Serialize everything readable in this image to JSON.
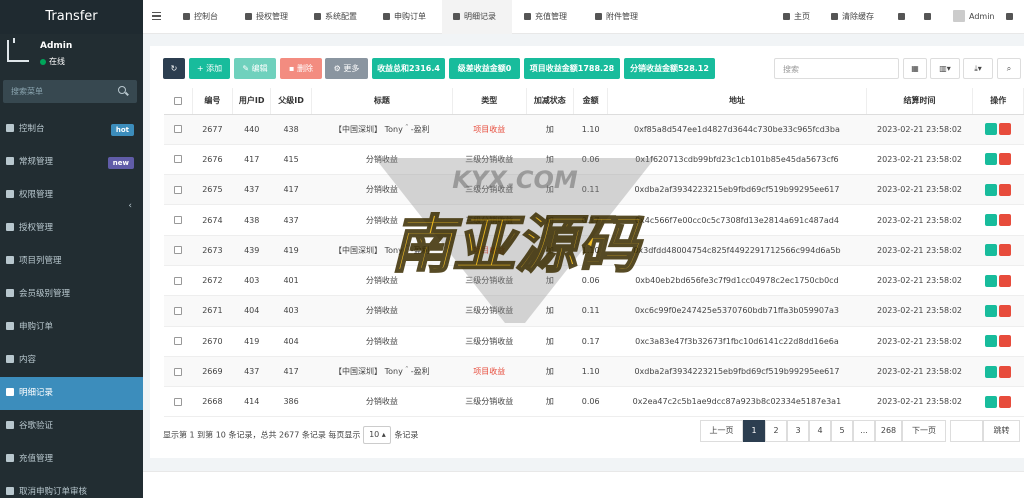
{
  "brand": "Transfer",
  "user": {
    "name": "Admin",
    "status": "在线"
  },
  "sidebar": {
    "search_placeholder": "搜索菜单",
    "items": [
      {
        "label": "控制台",
        "badge": "hot"
      },
      {
        "label": "常规管理",
        "badge": "new"
      },
      {
        "label": "权限管理",
        "badge": "",
        "chevron": "‹"
      },
      {
        "label": "授权管理",
        "badge": ""
      },
      {
        "label": "项目列管理",
        "badge": ""
      },
      {
        "label": "会员级别管理",
        "badge": ""
      },
      {
        "label": "申购订单",
        "badge": ""
      },
      {
        "label": "内容",
        "badge": ""
      },
      {
        "label": "明细记录",
        "badge": ""
      },
      {
        "label": "谷歌验证",
        "badge": ""
      },
      {
        "label": "充值管理",
        "badge": ""
      },
      {
        "label": "取消申购订单审核",
        "badge": ""
      }
    ]
  },
  "topbar": {
    "tabs": [
      "控制台",
      "授权管理",
      "系统配置",
      "申购订单",
      "明细记录",
      "充值管理",
      "附件管理"
    ],
    "right": {
      "home": "主页",
      "clear_cache": "清除缓存",
      "user": "Admin"
    }
  },
  "toolbar": {
    "add": "添加",
    "edit": "编辑",
    "delete": "删除",
    "more": "更多",
    "stats": [
      "收益总和2316.4",
      "级差收益金额0",
      "项目收益金额1788.28",
      "分销收益金额528.12"
    ],
    "search_placeholder": "搜索"
  },
  "table": {
    "headers": [
      "编号",
      "用户ID",
      "父级ID",
      "标题",
      "类型",
      "加减状态",
      "金额",
      "地址",
      "结算时间",
      "操作"
    ],
    "rows": [
      [
        "2677",
        "440",
        "438",
        "【中国深圳】 Tony＾-盈利",
        "项目收益",
        "加",
        "1.10",
        "0xf85a8d547ee1d4827d3644c730be33c965fcd3ba",
        "2023-02-21 23:58:02"
      ],
      [
        "2676",
        "417",
        "415",
        "分销收益",
        "三级分销收益",
        "加",
        "0.06",
        "0x1f620713cdb99bfd23c1cb101b85e45da5673cf6",
        "2023-02-21 23:58:02"
      ],
      [
        "2675",
        "437",
        "417",
        "分销收益",
        "三级分销收益",
        "加",
        "0.11",
        "0xdba2af3934223215eb9fbd69cf519b99295ee617",
        "2023-02-21 23:58:02"
      ],
      [
        "2674",
        "438",
        "437",
        "分销收益",
        "三级分销收益",
        "加",
        "0.17",
        "0x4c566f7e00cc0c5c7308fd13e2814a691c487ad4",
        "2023-02-21 23:58:02"
      ],
      [
        "2673",
        "439",
        "419",
        "【中国深圳】 Tony＾-盈利",
        "项目收益",
        "加",
        "1.10",
        "0x3dfdd48004754c825f4492291712566c994d6a5b",
        "2023-02-21 23:58:02"
      ],
      [
        "2672",
        "403",
        "401",
        "分销收益",
        "三级分销收益",
        "加",
        "0.06",
        "0xb40eb2bd656fe3c7f9d1cc04978c2ec1750cb0cd",
        "2023-02-21 23:58:02"
      ],
      [
        "2671",
        "404",
        "403",
        "分销收益",
        "三级分销收益",
        "加",
        "0.11",
        "0xc6c99f0e247425e5370760bdb71ffa3b059907a3",
        "2023-02-21 23:58:02"
      ],
      [
        "2670",
        "419",
        "404",
        "分销收益",
        "三级分销收益",
        "加",
        "0.17",
        "0xc3a83e47f3b32673f1fbc10d6141c22d8dd16e6a",
        "2023-02-21 23:58:02"
      ],
      [
        "2669",
        "437",
        "417",
        "【中国深圳】 Tony＾-盈利",
        "项目收益",
        "加",
        "1.10",
        "0xdba2af3934223215eb9fbd69cf519b99295ee617",
        "2023-02-21 23:58:02"
      ],
      [
        "2668",
        "414",
        "386",
        "分销收益",
        "三级分销收益",
        "加",
        "0.06",
        "0x2ea47c2c5b1ae9dcc87a923b8c02334e5187e3a1",
        "2023-02-21 23:58:02"
      ]
    ]
  },
  "pagination": {
    "info_prefix": "显示第 1 到第 10 条记录，总共 2677 条记录 每页显示",
    "page_size": "10",
    "info_suffix": "条记录",
    "prev": "上一页",
    "next": "下一页",
    "jump": "跳转",
    "pages": [
      "1",
      "2",
      "3",
      "4",
      "5",
      "...",
      "268"
    ]
  },
  "watermark": {
    "top": "KYX.COM",
    "main": "南亚源码"
  }
}
